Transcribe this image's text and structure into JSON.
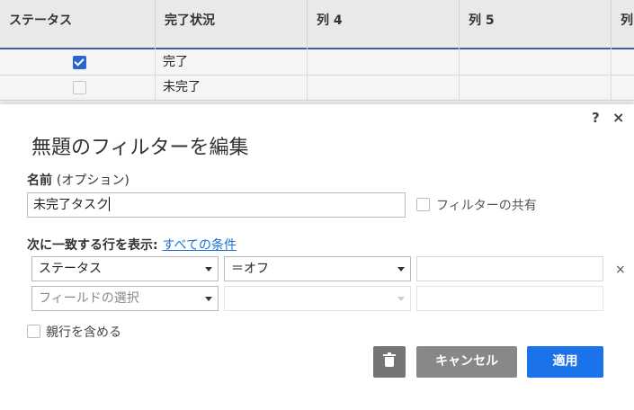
{
  "grid": {
    "columns": [
      "ステータス",
      "完了状況",
      "列 4",
      "列 5",
      "列"
    ],
    "rows": [
      {
        "checked": true,
        "status": "完了"
      },
      {
        "checked": false,
        "status": "未完了"
      }
    ]
  },
  "dialog": {
    "help_icon": "?",
    "close_icon": "×",
    "title": "無題のフィルターを編集",
    "name_label": "名前",
    "name_optional": "(オプション)",
    "name_value": "未完了タスク",
    "share_label": "フィルターの共有",
    "match_label": "次に一致する行を表示:",
    "match_link": "すべての条件",
    "conditions": [
      {
        "field": "ステータス",
        "operator": "＝オフ"
      },
      {
        "field_placeholder": "フィールドの選択"
      }
    ],
    "remove_icon": "×",
    "include_parents_label": "親行を含める",
    "cancel_label": "キャンセル",
    "apply_label": "適用",
    "delete_icon": "trash-icon"
  },
  "colors": {
    "accent": "#1a73e8",
    "header_rule": "#3f5da6",
    "checkbox_on": "#2b66cf"
  }
}
